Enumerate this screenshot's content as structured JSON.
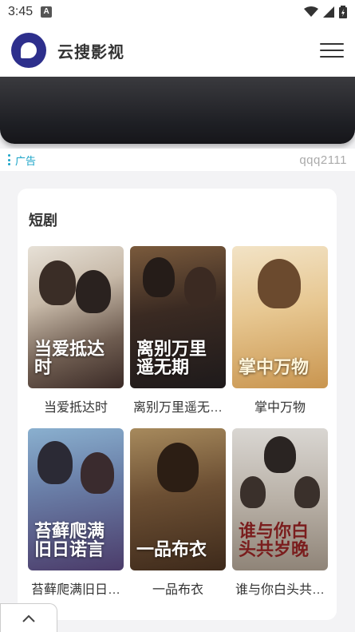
{
  "status_bar": {
    "time": "3:45",
    "notification_badge": "A"
  },
  "app_bar": {
    "title": "云搜影视",
    "menu_icon": "hamburger-menu-icon"
  },
  "ad": {
    "label": "广告",
    "account_id": "qqq2111"
  },
  "section": {
    "title": "短剧",
    "items": [
      {
        "name": "当爱抵达时",
        "poster_text": "当爱抵达时"
      },
      {
        "name": "离别万里遥无…",
        "poster_text": "离别万里遥无期"
      },
      {
        "name": "掌中万物",
        "poster_text": "掌中万物"
      },
      {
        "name": "苔藓爬满旧日…",
        "poster_text": "苔藓爬满旧日诺言"
      },
      {
        "name": "一品布衣",
        "poster_text": "一品布衣"
      },
      {
        "name": "谁与你白头共…",
        "poster_text": "谁与你白头共岁晚"
      }
    ]
  },
  "colors": {
    "brand": "#2d2f8c",
    "ad_accent": "#1aa4c8"
  }
}
